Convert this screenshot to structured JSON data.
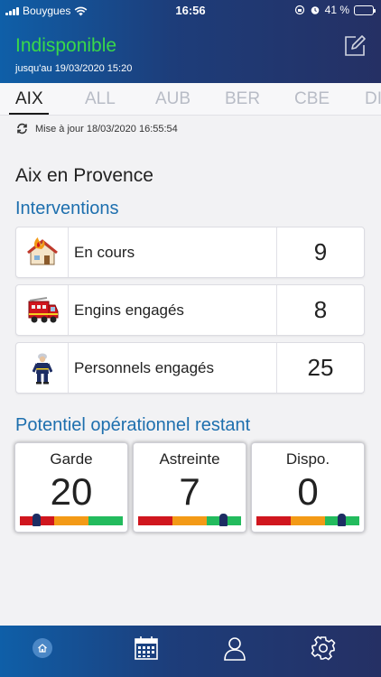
{
  "status_bar": {
    "carrier": "Bouygues",
    "time": "16:56",
    "battery": "41 %"
  },
  "header": {
    "status": "Indisponible",
    "until": "jusqu'au 19/03/2020 15:20",
    "edit_icon": "pencil-square-icon"
  },
  "tabs": [
    {
      "label": "AIX",
      "active": true
    },
    {
      "label": "ALL",
      "active": false
    },
    {
      "label": "AUB",
      "active": false
    },
    {
      "label": "BER",
      "active": false
    },
    {
      "label": "CBE",
      "active": false
    },
    {
      "label": "DI",
      "active": false
    }
  ],
  "update": {
    "icon": "refresh-icon",
    "text": "Mise à jour 18/03/2020 16:55:54"
  },
  "city": "Aix en Provence",
  "interventions": {
    "title": "Interventions",
    "rows": [
      {
        "icon": "burning-house-icon",
        "label": "En cours",
        "value": "9"
      },
      {
        "icon": "fire-truck-icon",
        "label": "Engins engagés",
        "value": "8"
      },
      {
        "icon": "firefighter-icon",
        "label": "Personnels engagés",
        "value": "25"
      }
    ]
  },
  "potential": {
    "title": "Potentiel opérationnel restant",
    "colors": {
      "low": "#d0161e",
      "mid": "#f39a16",
      "high": "#23bb5d"
    },
    "cards": [
      {
        "label": "Garde",
        "value": "20",
        "level": 0.16
      },
      {
        "label": "Astreinte",
        "value": "7",
        "level": 0.83
      },
      {
        "label": "Dispo.",
        "value": "0",
        "level": 0.83
      }
    ]
  },
  "bottom_nav": [
    {
      "icon": "home-icon",
      "active": true
    },
    {
      "icon": "calendar-icon",
      "active": false
    },
    {
      "icon": "user-icon",
      "active": false
    },
    {
      "icon": "gear-icon",
      "active": false
    }
  ]
}
